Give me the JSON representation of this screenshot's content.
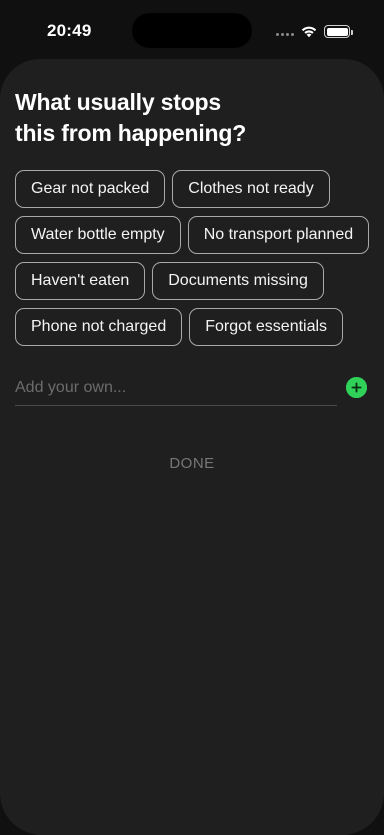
{
  "status_bar": {
    "time": "20:49",
    "icons": [
      "signal-dots-icon",
      "wifi-icon",
      "battery-icon"
    ]
  },
  "sheet": {
    "title_line1": "What usually stops",
    "title_line2": "this from happening?",
    "chip_rows": [
      [
        "Gear not packed",
        "Clothes not ready"
      ],
      [
        "Water bottle empty",
        "No transport planned"
      ],
      [
        "Haven't eaten",
        "Documents missing"
      ],
      [
        "Phone not charged",
        "Forgot essentials"
      ]
    ],
    "add_input": {
      "placeholder": "Add your own...",
      "value": ""
    },
    "add_button_icon": "plus-circle-icon",
    "done_label": "DONE"
  },
  "colors": {
    "background": "#1f1f1f",
    "chip_border": "#a9a9a9",
    "accent_green": "#2fd158",
    "done_text": "#777777"
  }
}
